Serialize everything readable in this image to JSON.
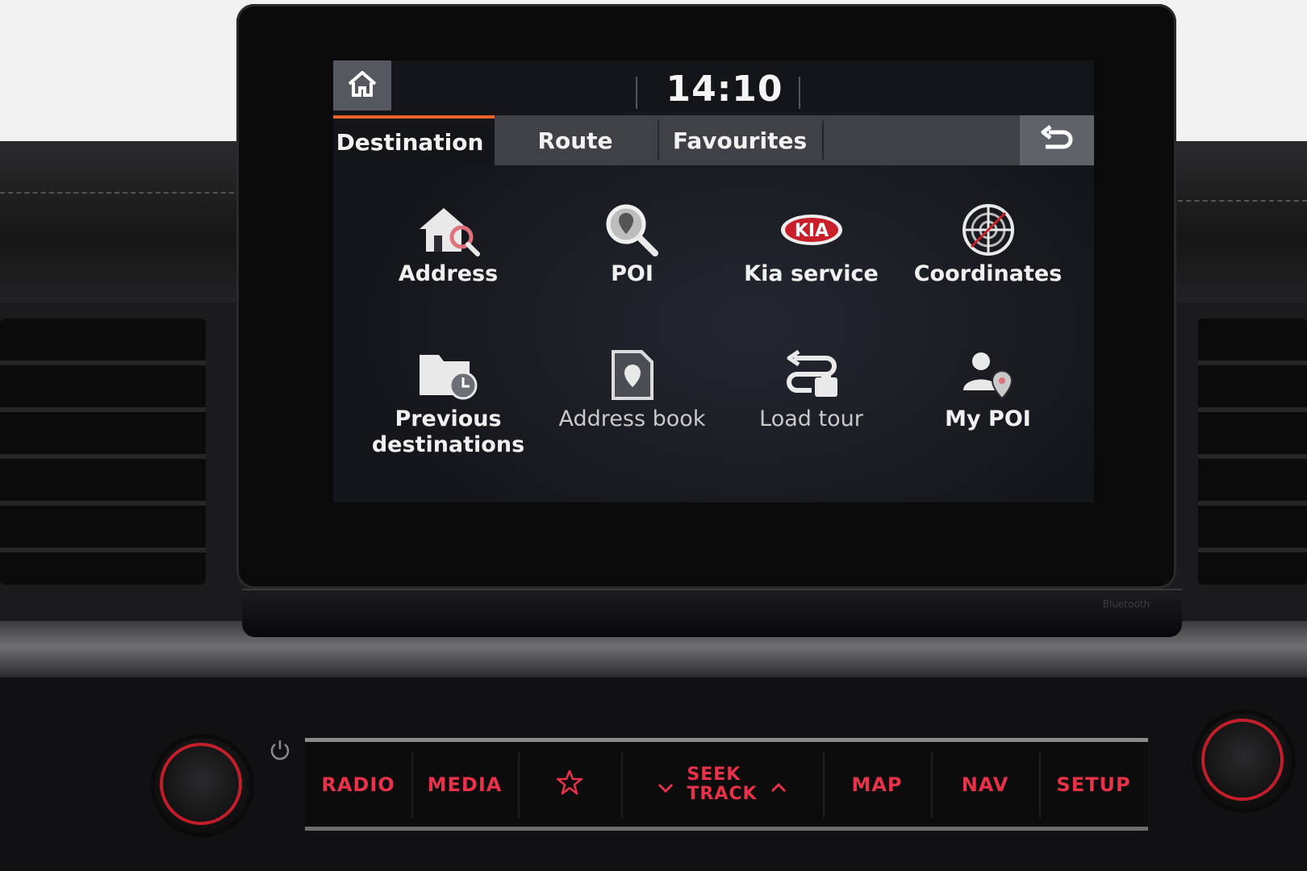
{
  "head_unit": {
    "clock": "14:10",
    "tabs": [
      {
        "label": "Destination",
        "active": true
      },
      {
        "label": "Route",
        "active": false
      },
      {
        "label": "Favourites",
        "active": false
      }
    ],
    "menu": [
      {
        "label": "Address",
        "icon": "house-search-icon"
      },
      {
        "label": "POI",
        "icon": "magnifier-pin-icon"
      },
      {
        "label": "Kia service",
        "icon": "kia-logo-icon"
      },
      {
        "label": "Coordinates",
        "icon": "globe-target-icon"
      },
      {
        "label": "Previous destinations",
        "line1": "Previous",
        "line2": "destinations",
        "icon": "folder-clock-icon"
      },
      {
        "label": "Address book",
        "icon": "address-book-icon"
      },
      {
        "label": "Load tour",
        "icon": "route-tour-icon"
      },
      {
        "label": "My POI",
        "icon": "person-pin-icon"
      }
    ],
    "icons": {
      "home": "home-icon",
      "back": "back-arrow-icon"
    },
    "accent": "#e8632a"
  },
  "bezel": {
    "bluetooth_label": "Bluetooth"
  },
  "controls": {
    "radio": "RADIO",
    "media": "MEDIA",
    "favourite_icon": "star-icon",
    "seek_line1": "SEEK",
    "seek_line2": "TRACK",
    "map": "MAP",
    "nav": "NAV",
    "setup": "SETUP",
    "button_color": "#e8324a"
  }
}
